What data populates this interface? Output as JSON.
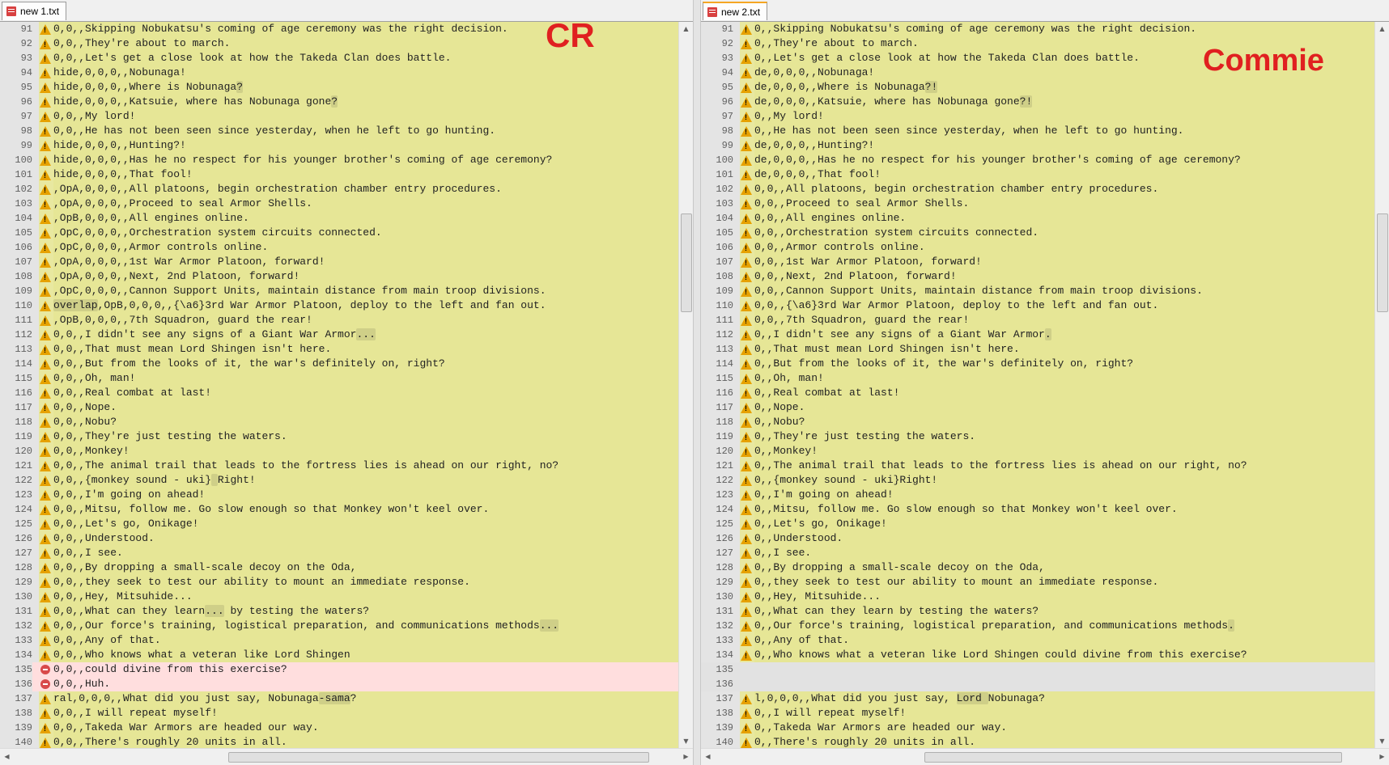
{
  "left": {
    "tab": "new  1.txt",
    "overlay": "CR",
    "lines": [
      {
        "n": "91",
        "marker": "warn",
        "segs": [
          {
            "t": "0,0,,Skipping Nobukatsu's coming of age ceremony was the right decision."
          }
        ]
      },
      {
        "n": "92",
        "marker": "warn",
        "segs": [
          {
            "t": "0,0,,They're about to march."
          }
        ]
      },
      {
        "n": "93",
        "marker": "warn",
        "segs": [
          {
            "t": "0,0,,Let's get a close look at how the Takeda Clan does battle."
          }
        ]
      },
      {
        "n": "94",
        "marker": "warn",
        "segs": [
          {
            "t": "hide,0,0,0,,Nobunaga!"
          }
        ]
      },
      {
        "n": "95",
        "marker": "warn",
        "segs": [
          {
            "t": "hide,0,0,0,,Where is Nobunaga"
          },
          {
            "t": "?",
            "hl": true
          }
        ]
      },
      {
        "n": "96",
        "marker": "warn",
        "segs": [
          {
            "t": "hide,0,0,0,,Katsuie, where has Nobunaga gone"
          },
          {
            "t": "?",
            "hl": true
          }
        ]
      },
      {
        "n": "97",
        "marker": "warn",
        "segs": [
          {
            "t": "0,0,,My lord!"
          }
        ]
      },
      {
        "n": "98",
        "marker": "warn",
        "segs": [
          {
            "t": "0,0,,He has not been seen since yesterday, when he left to go hunting."
          }
        ]
      },
      {
        "n": "99",
        "marker": "warn",
        "segs": [
          {
            "t": "hide,0,0,0,,Hunting?!"
          }
        ]
      },
      {
        "n": "100",
        "marker": "warn",
        "segs": [
          {
            "t": "hide,0,0,0,,Has he no respect for his younger brother's coming of age ceremony?"
          }
        ]
      },
      {
        "n": "101",
        "marker": "warn",
        "segs": [
          {
            "t": "hide,0,0,0,,That fool!"
          }
        ]
      },
      {
        "n": "102",
        "marker": "warn",
        "segs": [
          {
            "t": ",OpA,0,0,0,,All platoons, begin orchestration chamber entry procedures."
          }
        ]
      },
      {
        "n": "103",
        "marker": "warn",
        "segs": [
          {
            "t": ",OpA,0,0,0,,Proceed to seal Armor Shells."
          }
        ]
      },
      {
        "n": "104",
        "marker": "warn",
        "segs": [
          {
            "t": ",OpB,0,0,0,,All engines online."
          }
        ]
      },
      {
        "n": "105",
        "marker": "warn",
        "segs": [
          {
            "t": ",OpC,0,0,0,,Orchestration system circuits connected."
          }
        ]
      },
      {
        "n": "106",
        "marker": "warn",
        "segs": [
          {
            "t": ",OpC,0,0,0,,Armor controls online."
          }
        ]
      },
      {
        "n": "107",
        "marker": "warn",
        "segs": [
          {
            "t": ",OpA,0,0,0,,1st War Armor Platoon, forward!"
          }
        ]
      },
      {
        "n": "108",
        "marker": "warn",
        "segs": [
          {
            "t": ",OpA,0,0,0,,Next, 2nd Platoon, forward!"
          }
        ]
      },
      {
        "n": "109",
        "marker": "warn",
        "segs": [
          {
            "t": ",OpC,0,0,0,,Cannon Support Units, maintain distance from main troop divisions."
          }
        ]
      },
      {
        "n": "110",
        "marker": "warn",
        "segs": [
          {
            "t": "overlap",
            "hl": true
          },
          {
            "t": ",OpB,0,0,0,,{\\a6}3rd War Armor Platoon, deploy to the left and fan out."
          }
        ]
      },
      {
        "n": "111",
        "marker": "warn",
        "segs": [
          {
            "t": ",OpB,0,0,0,,7th Squadron, guard the rear!"
          }
        ]
      },
      {
        "n": "112",
        "marker": "warn",
        "segs": [
          {
            "t": "0,0,,I didn't see any signs of a Giant War Armor"
          },
          {
            "t": "...",
            "hl": true
          }
        ]
      },
      {
        "n": "113",
        "marker": "warn",
        "segs": [
          {
            "t": "0,0,,That must mean Lord Shingen isn't here."
          }
        ]
      },
      {
        "n": "114",
        "marker": "warn",
        "segs": [
          {
            "t": "0,0,,But from the looks of it, the war's definitely on, right?"
          }
        ]
      },
      {
        "n": "115",
        "marker": "warn",
        "segs": [
          {
            "t": "0,0,,Oh, man!"
          }
        ]
      },
      {
        "n": "116",
        "marker": "warn",
        "segs": [
          {
            "t": "0,0,,Real combat at last!"
          }
        ]
      },
      {
        "n": "117",
        "marker": "warn",
        "segs": [
          {
            "t": "0,0,,Nope."
          }
        ]
      },
      {
        "n": "118",
        "marker": "warn",
        "segs": [
          {
            "t": "0,0,,Nobu?"
          }
        ]
      },
      {
        "n": "119",
        "marker": "warn",
        "segs": [
          {
            "t": "0,0,,They're just testing the waters."
          }
        ]
      },
      {
        "n": "120",
        "marker": "warn",
        "segs": [
          {
            "t": "0,0,,Monkey!"
          }
        ]
      },
      {
        "n": "121",
        "marker": "warn",
        "segs": [
          {
            "t": "0,0,,The animal trail that leads to the fortress lies is ahead on our right, no?"
          }
        ]
      },
      {
        "n": "122",
        "marker": "warn",
        "segs": [
          {
            "t": "0,0,,{monkey sound - uki}"
          },
          {
            "t": " ",
            "hl": true
          },
          {
            "t": "Right!"
          }
        ]
      },
      {
        "n": "123",
        "marker": "warn",
        "segs": [
          {
            "t": "0,0,,I'm going on ahead!"
          }
        ]
      },
      {
        "n": "124",
        "marker": "warn",
        "segs": [
          {
            "t": "0,0,,Mitsu, follow me. Go slow enough so that Monkey won't keel over."
          }
        ]
      },
      {
        "n": "125",
        "marker": "warn",
        "segs": [
          {
            "t": "0,0,,Let's go, Onikage!"
          }
        ]
      },
      {
        "n": "126",
        "marker": "warn",
        "segs": [
          {
            "t": "0,0,,Understood."
          }
        ]
      },
      {
        "n": "127",
        "marker": "warn",
        "segs": [
          {
            "t": "0,0,,I see."
          }
        ]
      },
      {
        "n": "128",
        "marker": "warn",
        "segs": [
          {
            "t": "0,0,,By dropping a small-scale decoy on the Oda,"
          }
        ]
      },
      {
        "n": "129",
        "marker": "warn",
        "segs": [
          {
            "t": "0,0,,they seek to test our ability to mount an immediate response."
          }
        ]
      },
      {
        "n": "130",
        "marker": "warn",
        "segs": [
          {
            "t": "0,0,,Hey, Mitsuhide..."
          }
        ]
      },
      {
        "n": "131",
        "marker": "warn",
        "segs": [
          {
            "t": "0,0,,What can they learn"
          },
          {
            "t": "...",
            "hl": true
          },
          {
            "t": " by testing the waters?"
          }
        ]
      },
      {
        "n": "132",
        "marker": "warn",
        "segs": [
          {
            "t": "0,0,,Our force's training, logistical preparation, and communications methods"
          },
          {
            "t": "...",
            "hl": true
          }
        ]
      },
      {
        "n": "133",
        "marker": "warn",
        "segs": [
          {
            "t": "0,0,,Any of that."
          }
        ]
      },
      {
        "n": "134",
        "marker": "warn",
        "segs": [
          {
            "t": "0,0,,Who knows what a veteran like Lord Shingen"
          }
        ]
      },
      {
        "n": "135",
        "marker": "minus",
        "kind": "removed",
        "segs": [
          {
            "t": "0,0,,could divine from this exercise?"
          }
        ]
      },
      {
        "n": "136",
        "marker": "minus",
        "kind": "removed",
        "segs": [
          {
            "t": "0,0,,Huh."
          }
        ]
      },
      {
        "n": "137",
        "marker": "warn",
        "segs": [
          {
            "t": "ral,0,0,0,,What did you just say, Nobunaga"
          },
          {
            "t": "-sama",
            "hl": true
          },
          {
            "t": "?"
          }
        ]
      },
      {
        "n": "138",
        "marker": "warn",
        "segs": [
          {
            "t": "0,0,,I will repeat myself!"
          }
        ]
      },
      {
        "n": "139",
        "marker": "warn",
        "segs": [
          {
            "t": "0,0,,Takeda War Armors are headed our way."
          }
        ]
      },
      {
        "n": "140",
        "marker": "warn",
        "segs": [
          {
            "t": "0,0,,There's roughly 20 units in all."
          }
        ]
      }
    ]
  },
  "right": {
    "tab": "new  2.txt",
    "overlay": "Commie",
    "lines": [
      {
        "n": "91",
        "marker": "warn",
        "segs": [
          {
            "t": "0,,Skipping Nobukatsu's coming of age ceremony was the right decision."
          }
        ]
      },
      {
        "n": "92",
        "marker": "warn",
        "segs": [
          {
            "t": "0,,They're about to march."
          }
        ]
      },
      {
        "n": "93",
        "marker": "warn",
        "segs": [
          {
            "t": "0,,Let's get a close look at how the Takeda Clan does battle."
          }
        ]
      },
      {
        "n": "94",
        "marker": "warn",
        "segs": [
          {
            "t": "de,0,0,0,,Nobunaga!"
          }
        ]
      },
      {
        "n": "95",
        "marker": "warn",
        "segs": [
          {
            "t": "de,0,0,0,,Where is Nobunaga"
          },
          {
            "t": "?!",
            "hl": true
          }
        ]
      },
      {
        "n": "96",
        "marker": "warn",
        "segs": [
          {
            "t": "de,0,0,0,,Katsuie, where has Nobunaga gone"
          },
          {
            "t": "?!",
            "hl": true
          }
        ]
      },
      {
        "n": "97",
        "marker": "warn",
        "segs": [
          {
            "t": "0,,My lord!"
          }
        ]
      },
      {
        "n": "98",
        "marker": "warn",
        "segs": [
          {
            "t": "0,,He has not been seen since yesterday, when he left to go hunting."
          }
        ]
      },
      {
        "n": "99",
        "marker": "warn",
        "segs": [
          {
            "t": "de,0,0,0,,Hunting?!"
          }
        ]
      },
      {
        "n": "100",
        "marker": "warn",
        "segs": [
          {
            "t": "de,0,0,0,,Has he no respect for his younger brother's coming of age ceremony?"
          }
        ]
      },
      {
        "n": "101",
        "marker": "warn",
        "segs": [
          {
            "t": "de,0,0,0,,That fool!"
          }
        ]
      },
      {
        "n": "102",
        "marker": "warn",
        "segs": [
          {
            "t": "0,0,,All platoons, begin orchestration chamber entry procedures."
          }
        ]
      },
      {
        "n": "103",
        "marker": "warn",
        "segs": [
          {
            "t": "0,0,,Proceed to seal Armor Shells."
          }
        ]
      },
      {
        "n": "104",
        "marker": "warn",
        "segs": [
          {
            "t": "0,0,,All engines online."
          }
        ]
      },
      {
        "n": "105",
        "marker": "warn",
        "segs": [
          {
            "t": "0,0,,Orchestration system circuits connected."
          }
        ]
      },
      {
        "n": "106",
        "marker": "warn",
        "segs": [
          {
            "t": "0,0,,Armor controls online."
          }
        ]
      },
      {
        "n": "107",
        "marker": "warn",
        "segs": [
          {
            "t": "0,0,,1st War Armor Platoon, forward!"
          }
        ]
      },
      {
        "n": "108",
        "marker": "warn",
        "segs": [
          {
            "t": "0,0,,Next, 2nd Platoon, forward!"
          }
        ]
      },
      {
        "n": "109",
        "marker": "warn",
        "segs": [
          {
            "t": "0,0,,Cannon Support Units, maintain distance from main troop divisions."
          }
        ]
      },
      {
        "n": "110",
        "marker": "warn",
        "segs": [
          {
            "t": "0,0,,{\\a6}3rd War Armor Platoon, deploy to the left and fan out."
          }
        ]
      },
      {
        "n": "111",
        "marker": "warn",
        "segs": [
          {
            "t": "0,0,,7th Squadron, guard the rear!"
          }
        ]
      },
      {
        "n": "112",
        "marker": "warn",
        "segs": [
          {
            "t": "0,,I didn't see any signs of a Giant War Armor"
          },
          {
            "t": ".",
            "hl": true
          }
        ]
      },
      {
        "n": "113",
        "marker": "warn",
        "segs": [
          {
            "t": "0,,That must mean Lord Shingen isn't here."
          }
        ]
      },
      {
        "n": "114",
        "marker": "warn",
        "segs": [
          {
            "t": "0,,But from the looks of it, the war's definitely on, right?"
          }
        ]
      },
      {
        "n": "115",
        "marker": "warn",
        "segs": [
          {
            "t": "0,,Oh, man!"
          }
        ]
      },
      {
        "n": "116",
        "marker": "warn",
        "segs": [
          {
            "t": "0,,Real combat at last!"
          }
        ]
      },
      {
        "n": "117",
        "marker": "warn",
        "segs": [
          {
            "t": "0,,Nope."
          }
        ]
      },
      {
        "n": "118",
        "marker": "warn",
        "segs": [
          {
            "t": "0,,Nobu?"
          }
        ]
      },
      {
        "n": "119",
        "marker": "warn",
        "segs": [
          {
            "t": "0,,They're just testing the waters."
          }
        ]
      },
      {
        "n": "120",
        "marker": "warn",
        "segs": [
          {
            "t": "0,,Monkey!"
          }
        ]
      },
      {
        "n": "121",
        "marker": "warn",
        "segs": [
          {
            "t": "0,,The animal trail that leads to the fortress lies is ahead on our right, no?"
          }
        ]
      },
      {
        "n": "122",
        "marker": "warn",
        "segs": [
          {
            "t": "0,,{monkey sound - uki}Right!"
          }
        ]
      },
      {
        "n": "123",
        "marker": "warn",
        "segs": [
          {
            "t": "0,,I'm going on ahead!"
          }
        ]
      },
      {
        "n": "124",
        "marker": "warn",
        "segs": [
          {
            "t": "0,,Mitsu, follow me. Go slow enough so that Monkey won't keel over."
          }
        ]
      },
      {
        "n": "125",
        "marker": "warn",
        "segs": [
          {
            "t": "0,,Let's go, Onikage!"
          }
        ]
      },
      {
        "n": "126",
        "marker": "warn",
        "segs": [
          {
            "t": "0,,Understood."
          }
        ]
      },
      {
        "n": "127",
        "marker": "warn",
        "segs": [
          {
            "t": "0,,I see."
          }
        ]
      },
      {
        "n": "128",
        "marker": "warn",
        "segs": [
          {
            "t": "0,,By dropping a small-scale decoy on the Oda,"
          }
        ]
      },
      {
        "n": "129",
        "marker": "warn",
        "segs": [
          {
            "t": "0,,they seek to test our ability to mount an immediate response."
          }
        ]
      },
      {
        "n": "130",
        "marker": "warn",
        "segs": [
          {
            "t": "0,,Hey, Mitsuhide..."
          }
        ]
      },
      {
        "n": "131",
        "marker": "warn",
        "segs": [
          {
            "t": "0,,What can they learn by testing the waters?"
          }
        ]
      },
      {
        "n": "132",
        "marker": "warn",
        "segs": [
          {
            "t": "0,,Our force's training, logistical preparation, and communications methods"
          },
          {
            "t": ".",
            "hl": true
          }
        ]
      },
      {
        "n": "133",
        "marker": "warn",
        "segs": [
          {
            "t": "0,,Any of that."
          }
        ]
      },
      {
        "n": "134",
        "marker": "warn",
        "segs": [
          {
            "t": "0,,Who knows what a veteran like Lord Shingen could divine from this exercise?"
          }
        ]
      },
      {
        "n": "135",
        "marker": "none",
        "kind": "blank",
        "segs": []
      },
      {
        "n": "136",
        "marker": "none",
        "kind": "blank",
        "segs": []
      },
      {
        "n": "137",
        "marker": "warn",
        "segs": [
          {
            "t": "l,0,0,0,,What did you just say, "
          },
          {
            "t": "Lord ",
            "hl": true
          },
          {
            "t": "Nobunaga?"
          }
        ]
      },
      {
        "n": "138",
        "marker": "warn",
        "segs": [
          {
            "t": "0,,I will repeat myself!"
          }
        ]
      },
      {
        "n": "139",
        "marker": "warn",
        "segs": [
          {
            "t": "0,,Takeda War Armors are headed our way."
          }
        ]
      },
      {
        "n": "140",
        "marker": "warn",
        "segs": [
          {
            "t": "0,,There's roughly 20 units in all."
          }
        ]
      }
    ]
  },
  "colors": {
    "changed_bg": "#e6e696",
    "removed_bg": "#ffdede",
    "highlight": "#cfcf88",
    "overlay_text": "#e02020",
    "tab_accent": "#f5a623"
  },
  "icons": {
    "changed_marker": "warning-icon",
    "removed_marker": "minus-circle-icon",
    "tab_icon": "file-icon"
  }
}
